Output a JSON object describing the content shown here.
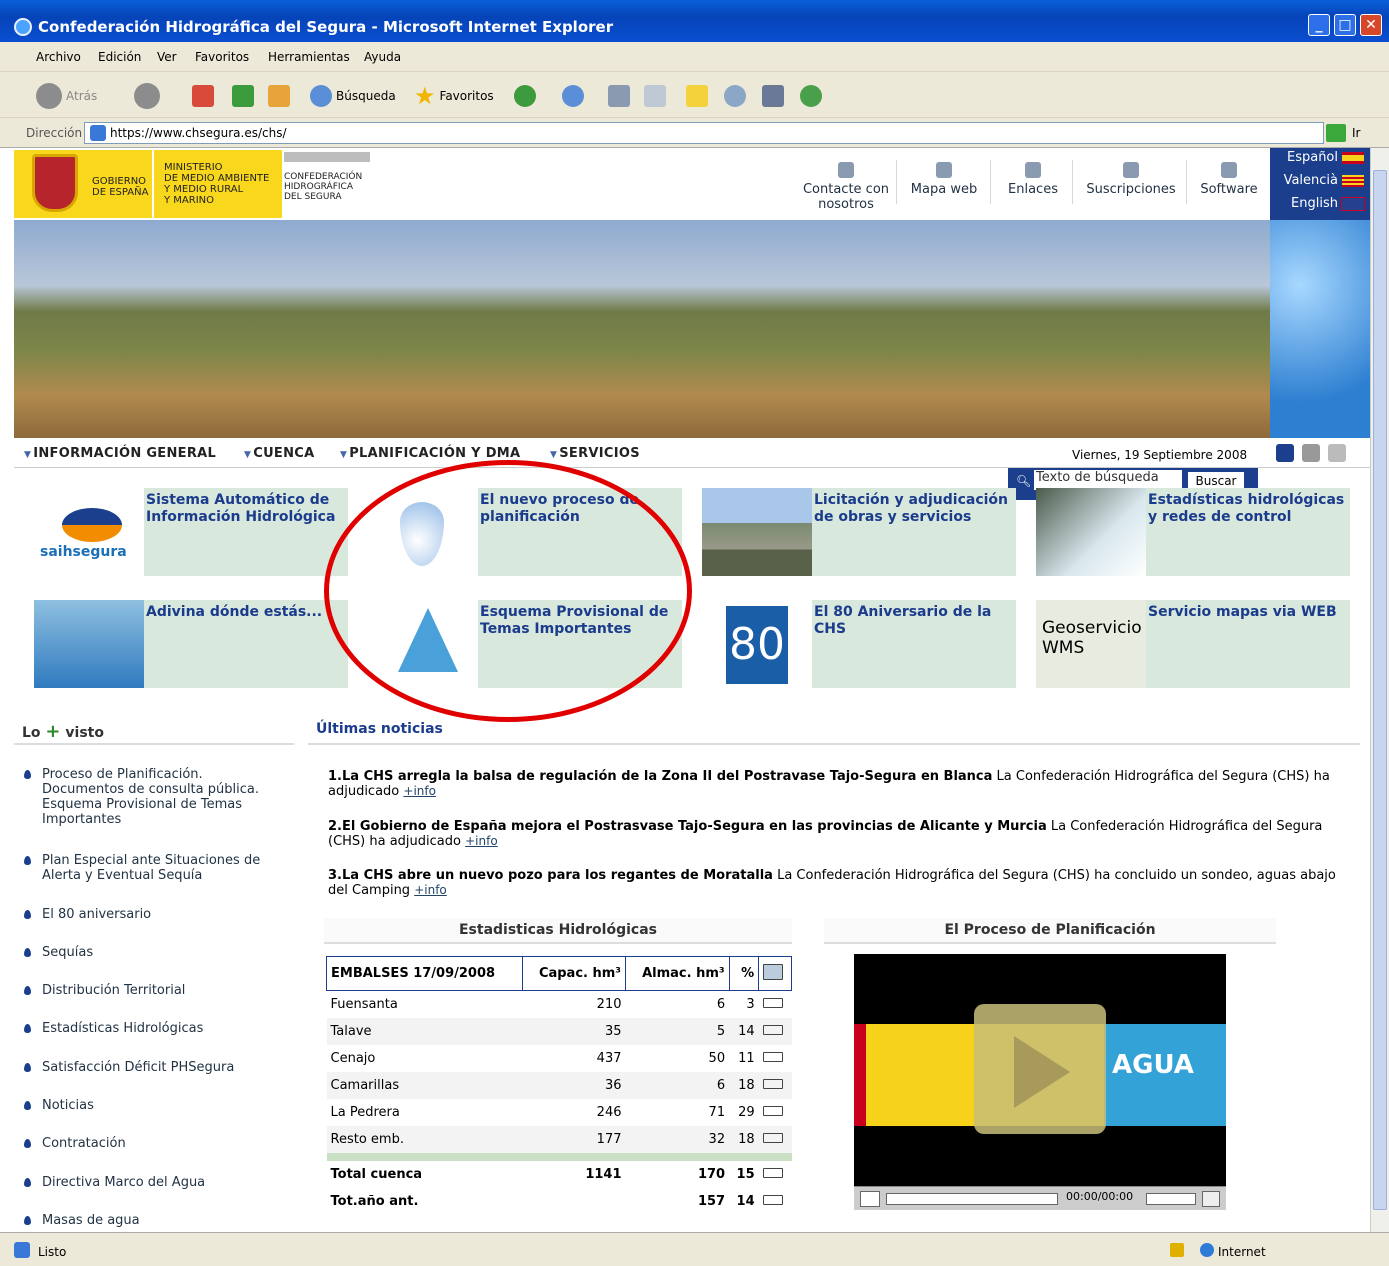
{
  "window": {
    "title": "Confederación Hidrográfica del Segura - Microsoft Internet Explorer"
  },
  "menu": [
    "Archivo",
    "Edición",
    "Ver",
    "Favoritos",
    "Herramientas",
    "Ayuda"
  ],
  "toolbar": {
    "back": "Atrás",
    "search": "Búsqueda",
    "favorites": "Favoritos"
  },
  "address": {
    "label": "Dirección",
    "url": "https://www.chsegura.es/chs/",
    "go": "Ir"
  },
  "header": {
    "gov1": "GOBIERNO\nDE ESPAÑA",
    "gov2": "MINISTERIO\nDE MEDIO AMBIENTE\nY MEDIO RURAL\nY MARINO",
    "gov3": "CONFEDERACIÓN\nHIDROGRÁFICA\nDEL SEGURA",
    "tools": [
      "Contacte con nosotros",
      "Mapa web",
      "Enlaces",
      "Suscripciones",
      "Software"
    ],
    "langs": [
      "Español",
      "Valencià",
      "English"
    ]
  },
  "search": {
    "placeholder": "Texto de búsqueda",
    "button": "Buscar"
  },
  "nav": {
    "items": [
      "INFORMACIÓN GENERAL",
      "CUENCA",
      "PLANIFICACIÓN Y DMA",
      "SERVICIOS"
    ],
    "date": "Viernes, 19 Septiembre 2008"
  },
  "tiles": [
    {
      "title": "Sistema Automático de Información Hidrológica",
      "img": "saihsegura"
    },
    {
      "title": "El nuevo proceso de planificación"
    },
    {
      "title": "Licitación y adjudicación de obras y servicios"
    },
    {
      "title": "Estadísticas hidrológicas y redes de control"
    },
    {
      "title": "Adivina dónde estás..."
    },
    {
      "title": "Esquema Provisional de Temas Importantes"
    },
    {
      "title": "El 80 Aniversario de la CHS",
      "img": "80"
    },
    {
      "title": "Servicio mapas via WEB",
      "img": "Geoservicio WMS"
    }
  ],
  "left": {
    "title_a": "Lo",
    "title_b": "visto",
    "items": [
      "Proceso de Planificación. Documentos de consulta pública. Esquema Provisional de Temas Importantes",
      "Plan Especial ante Situaciones de Alerta y Eventual Sequía",
      "El 80 aniversario",
      "Sequías",
      "Distribución Territorial",
      "Estadísticas Hidrológicas",
      "Satisfacción Déficit PHSegura",
      "Noticias",
      "Contratación",
      "Directiva Marco del Agua",
      "Masas de agua"
    ]
  },
  "news": {
    "title": "Últimas noticias",
    "items": [
      {
        "bold": "1.La CHS arregla la balsa de regulación de la Zona II del Postravase Tajo-Segura en Blanca",
        "text": " La Confederación Hidrográfica del Segura (CHS) ha adjudicado ",
        "more": "+info"
      },
      {
        "bold": "2.El Gobierno de España mejora el Postrasvase Tajo-Segura en las provincias de Alicante y Murcia",
        "text": " La Confederación Hidrográfica del Segura (CHS) ha adjudicado ",
        "more": "+info"
      },
      {
        "bold": "3.La CHS abre un nuevo pozo para los regantes de Moratalla",
        "text": " La Confederación Hidrográfica del Segura (CHS) ha concluido un sondeo, aguas abajo del Camping ",
        "more": "+info"
      }
    ]
  },
  "stats": {
    "title": "Estadisticas Hidrológicas",
    "headers": [
      "EMBALSES 17/09/2008",
      "Capac. hm³",
      "Almac. hm³",
      "%"
    ],
    "rows": [
      [
        "Fuensanta",
        "210",
        "6",
        "3"
      ],
      [
        "Talave",
        "35",
        "5",
        "14"
      ],
      [
        "Cenajo",
        "437",
        "50",
        "11"
      ],
      [
        "Camarillas",
        "36",
        "6",
        "18"
      ],
      [
        "La Pedrera",
        "246",
        "71",
        "29"
      ],
      [
        "Resto emb.",
        "177",
        "32",
        "18"
      ]
    ],
    "total": [
      "Total cuenca",
      "1141",
      "170",
      "15"
    ],
    "prev": [
      "Tot.año ant.",
      "",
      "157",
      "14"
    ]
  },
  "video": {
    "title": "El Proceso de Planificación",
    "brand": "AGUA",
    "time": "00:00/00:00"
  },
  "status": {
    "left": "Listo",
    "zone": "Internet"
  }
}
